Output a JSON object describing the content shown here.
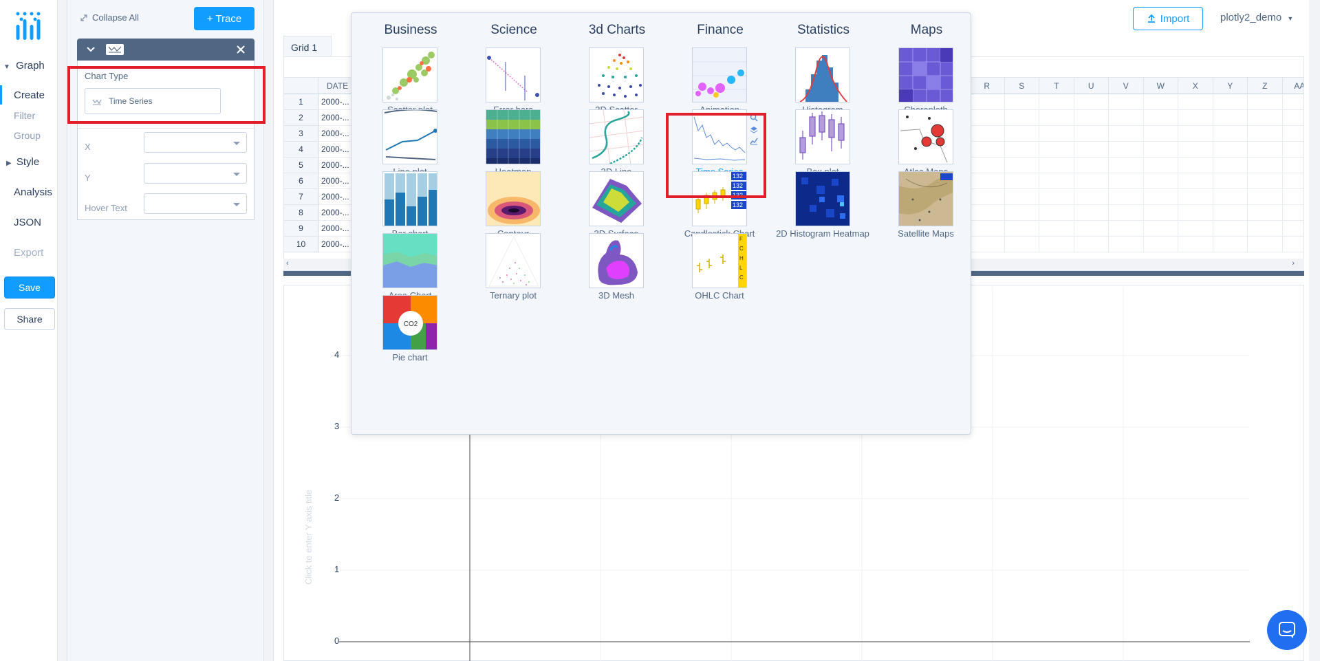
{
  "nav": {
    "graph": "Graph",
    "create": "Create",
    "filter": "Filter",
    "group": "Group",
    "style": "Style",
    "analysis": "Analysis",
    "json": "JSON",
    "export": "Export",
    "save": "Save",
    "share": "Share"
  },
  "panel": {
    "collapse_all": "Collapse All",
    "add_trace": "+ Trace",
    "chart_type_label": "Chart Type",
    "chart_type_value": "Time Series",
    "x_label": "X",
    "y_label": "Y",
    "hover_label": "Hover Text"
  },
  "topbar": {
    "import": "Import",
    "user": "plotly2_demo"
  },
  "grid": {
    "tab": "Grid 1",
    "date_col": "DATE",
    "right_cols": [
      "R",
      "S",
      "T",
      "U",
      "V",
      "W",
      "X",
      "Y",
      "Z",
      "AA"
    ],
    "rows": [
      "1",
      "2",
      "3",
      "4",
      "5",
      "6",
      "7",
      "8",
      "9",
      "10"
    ],
    "cell_value": "2000-..."
  },
  "plot": {
    "y_ticks": [
      "4",
      "3",
      "2",
      "1",
      "0"
    ],
    "y_title": "Click to enter Y axis title"
  },
  "popup": {
    "categories": [
      "Business",
      "Science",
      "3d Charts",
      "Finance",
      "Statistics",
      "Maps"
    ],
    "charts": {
      "business": [
        "Scatter plot",
        "Line plot",
        "Bar chart",
        "Area Chart",
        "Pie chart"
      ],
      "science": [
        "Error bars",
        "Heatmap",
        "Contour",
        "Ternary plot"
      ],
      "charts3d": [
        "3D Scatter",
        "3D Line",
        "3D Surface",
        "3D Mesh"
      ],
      "finance": [
        "Animation",
        "Time Series",
        "Candlestick Chart",
        "OHLC Chart"
      ],
      "statistics": [
        "Histogram",
        "Box plot",
        "2D Histogram Heatmap"
      ],
      "maps": [
        "Choropleth",
        "Atlas Maps",
        "Satellite Maps"
      ]
    },
    "selected": "Time Series",
    "pie_center": "CO2"
  },
  "colors": {
    "accent": "#119dff",
    "highlight": "#e11f2b",
    "panel_header": "#506784"
  }
}
